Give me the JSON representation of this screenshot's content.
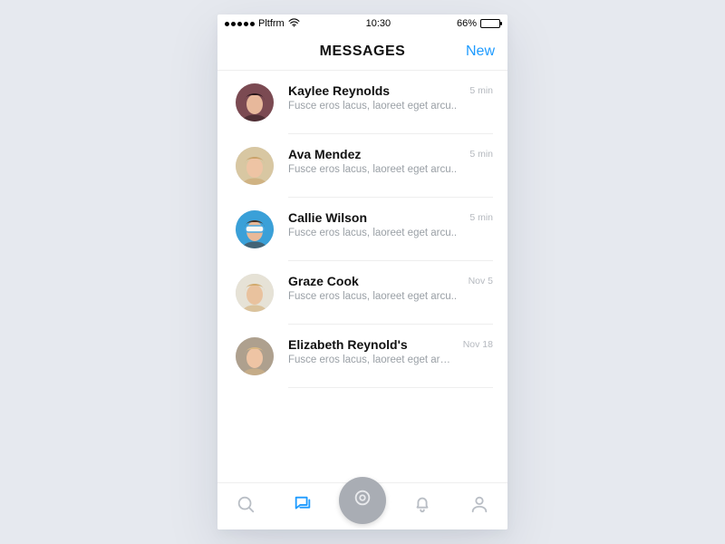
{
  "statusbar": {
    "carrier": "Pltfrm",
    "time": "10:30",
    "battery_pct": "66%"
  },
  "header": {
    "title": "MESSAGES",
    "new_label": "New"
  },
  "threads": [
    {
      "name": "Kaylee Reynolds",
      "preview": "Fusce eros lacus, laoreet eget arcu..",
      "time": "5 min",
      "avatar": "a1"
    },
    {
      "name": "Ava Mendez",
      "preview": "Fusce eros lacus, laoreet eget arcu..",
      "time": "5 min",
      "avatar": "a2"
    },
    {
      "name": "Callie Wilson",
      "preview": "Fusce eros lacus, laoreet eget arcu..",
      "time": "5 min",
      "avatar": "a3"
    },
    {
      "name": "Graze Cook",
      "preview": "Fusce eros lacus, laoreet eget arcu..",
      "time": "Nov 5",
      "avatar": "a4"
    },
    {
      "name": "Elizabeth Reynold's",
      "preview": "Fusce eros lacus, laoreet eget arcu..",
      "time": "Nov 18",
      "avatar": "a5"
    }
  ],
  "avatars": {
    "a1": {
      "bg": "#7b4a52",
      "hair": "#2c1a1d",
      "skin": "#e7b89b"
    },
    "a2": {
      "bg": "#d8c7a2",
      "hair": "#caa26a",
      "skin": "#eec4a4"
    },
    "a3": {
      "bg": "#3aa0d8",
      "hair": "#4a3326",
      "skin": "#e9b998",
      "goggles": true
    },
    "a4": {
      "bg": "#e6e2d6",
      "hair": "#d2aa6d",
      "skin": "#e9c29e"
    },
    "a5": {
      "bg": "#aea08e",
      "hair": "#d9b783",
      "skin": "#eec4a4"
    }
  },
  "tabbar": {
    "items": [
      {
        "name": "search",
        "active": false
      },
      {
        "name": "messages",
        "active": true
      },
      {
        "name": "camera",
        "active": false,
        "center": true
      },
      {
        "name": "alerts",
        "active": false
      },
      {
        "name": "profile",
        "active": false
      }
    ]
  }
}
